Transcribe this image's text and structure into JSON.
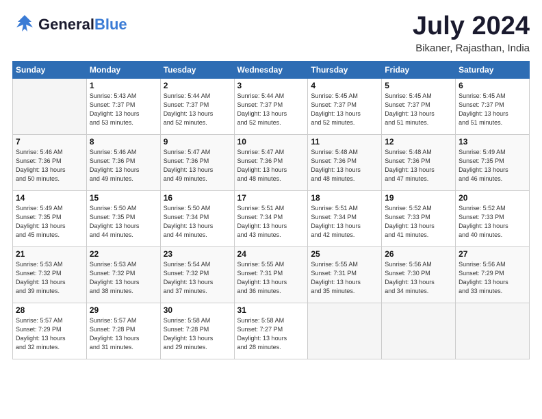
{
  "header": {
    "logo_general": "General",
    "logo_blue": "Blue",
    "month": "July 2024",
    "location": "Bikaner, Rajasthan, India"
  },
  "weekdays": [
    "Sunday",
    "Monday",
    "Tuesday",
    "Wednesday",
    "Thursday",
    "Friday",
    "Saturday"
  ],
  "weeks": [
    [
      {
        "day": "",
        "info": ""
      },
      {
        "day": "1",
        "info": "Sunrise: 5:43 AM\nSunset: 7:37 PM\nDaylight: 13 hours\nand 53 minutes."
      },
      {
        "day": "2",
        "info": "Sunrise: 5:44 AM\nSunset: 7:37 PM\nDaylight: 13 hours\nand 52 minutes."
      },
      {
        "day": "3",
        "info": "Sunrise: 5:44 AM\nSunset: 7:37 PM\nDaylight: 13 hours\nand 52 minutes."
      },
      {
        "day": "4",
        "info": "Sunrise: 5:45 AM\nSunset: 7:37 PM\nDaylight: 13 hours\nand 52 minutes."
      },
      {
        "day": "5",
        "info": "Sunrise: 5:45 AM\nSunset: 7:37 PM\nDaylight: 13 hours\nand 51 minutes."
      },
      {
        "day": "6",
        "info": "Sunrise: 5:45 AM\nSunset: 7:37 PM\nDaylight: 13 hours\nand 51 minutes."
      }
    ],
    [
      {
        "day": "7",
        "info": "Sunrise: 5:46 AM\nSunset: 7:36 PM\nDaylight: 13 hours\nand 50 minutes."
      },
      {
        "day": "8",
        "info": "Sunrise: 5:46 AM\nSunset: 7:36 PM\nDaylight: 13 hours\nand 49 minutes."
      },
      {
        "day": "9",
        "info": "Sunrise: 5:47 AM\nSunset: 7:36 PM\nDaylight: 13 hours\nand 49 minutes."
      },
      {
        "day": "10",
        "info": "Sunrise: 5:47 AM\nSunset: 7:36 PM\nDaylight: 13 hours\nand 48 minutes."
      },
      {
        "day": "11",
        "info": "Sunrise: 5:48 AM\nSunset: 7:36 PM\nDaylight: 13 hours\nand 48 minutes."
      },
      {
        "day": "12",
        "info": "Sunrise: 5:48 AM\nSunset: 7:36 PM\nDaylight: 13 hours\nand 47 minutes."
      },
      {
        "day": "13",
        "info": "Sunrise: 5:49 AM\nSunset: 7:35 PM\nDaylight: 13 hours\nand 46 minutes."
      }
    ],
    [
      {
        "day": "14",
        "info": "Sunrise: 5:49 AM\nSunset: 7:35 PM\nDaylight: 13 hours\nand 45 minutes."
      },
      {
        "day": "15",
        "info": "Sunrise: 5:50 AM\nSunset: 7:35 PM\nDaylight: 13 hours\nand 44 minutes."
      },
      {
        "day": "16",
        "info": "Sunrise: 5:50 AM\nSunset: 7:34 PM\nDaylight: 13 hours\nand 44 minutes."
      },
      {
        "day": "17",
        "info": "Sunrise: 5:51 AM\nSunset: 7:34 PM\nDaylight: 13 hours\nand 43 minutes."
      },
      {
        "day": "18",
        "info": "Sunrise: 5:51 AM\nSunset: 7:34 PM\nDaylight: 13 hours\nand 42 minutes."
      },
      {
        "day": "19",
        "info": "Sunrise: 5:52 AM\nSunset: 7:33 PM\nDaylight: 13 hours\nand 41 minutes."
      },
      {
        "day": "20",
        "info": "Sunrise: 5:52 AM\nSunset: 7:33 PM\nDaylight: 13 hours\nand 40 minutes."
      }
    ],
    [
      {
        "day": "21",
        "info": "Sunrise: 5:53 AM\nSunset: 7:32 PM\nDaylight: 13 hours\nand 39 minutes."
      },
      {
        "day": "22",
        "info": "Sunrise: 5:53 AM\nSunset: 7:32 PM\nDaylight: 13 hours\nand 38 minutes."
      },
      {
        "day": "23",
        "info": "Sunrise: 5:54 AM\nSunset: 7:32 PM\nDaylight: 13 hours\nand 37 minutes."
      },
      {
        "day": "24",
        "info": "Sunrise: 5:55 AM\nSunset: 7:31 PM\nDaylight: 13 hours\nand 36 minutes."
      },
      {
        "day": "25",
        "info": "Sunrise: 5:55 AM\nSunset: 7:31 PM\nDaylight: 13 hours\nand 35 minutes."
      },
      {
        "day": "26",
        "info": "Sunrise: 5:56 AM\nSunset: 7:30 PM\nDaylight: 13 hours\nand 34 minutes."
      },
      {
        "day": "27",
        "info": "Sunrise: 5:56 AM\nSunset: 7:29 PM\nDaylight: 13 hours\nand 33 minutes."
      }
    ],
    [
      {
        "day": "28",
        "info": "Sunrise: 5:57 AM\nSunset: 7:29 PM\nDaylight: 13 hours\nand 32 minutes."
      },
      {
        "day": "29",
        "info": "Sunrise: 5:57 AM\nSunset: 7:28 PM\nDaylight: 13 hours\nand 31 minutes."
      },
      {
        "day": "30",
        "info": "Sunrise: 5:58 AM\nSunset: 7:28 PM\nDaylight: 13 hours\nand 29 minutes."
      },
      {
        "day": "31",
        "info": "Sunrise: 5:58 AM\nSunset: 7:27 PM\nDaylight: 13 hours\nand 28 minutes."
      },
      {
        "day": "",
        "info": ""
      },
      {
        "day": "",
        "info": ""
      },
      {
        "day": "",
        "info": ""
      }
    ]
  ]
}
